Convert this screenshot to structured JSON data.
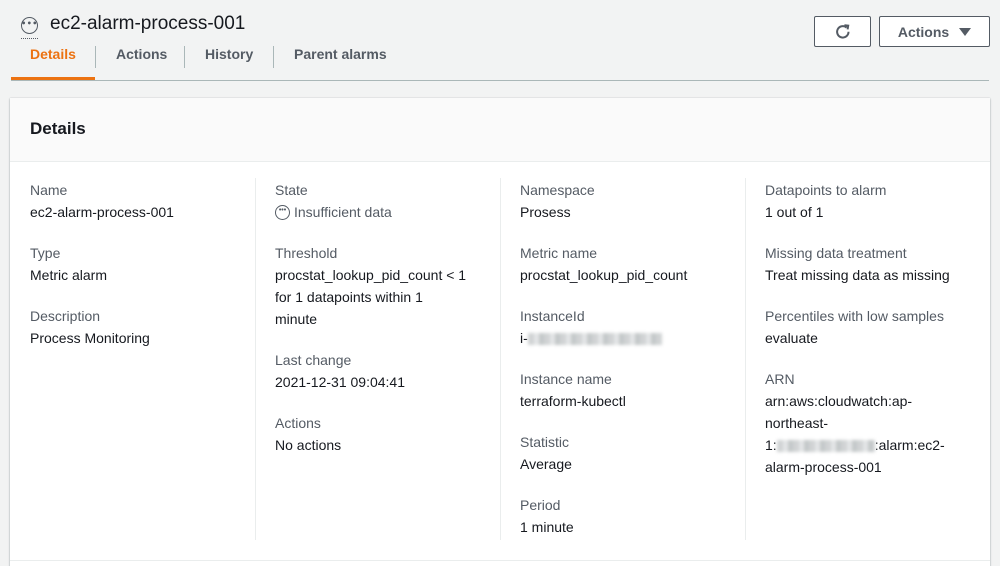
{
  "header": {
    "title": "ec2-alarm-process-001",
    "refresh_icon": "refresh-icon",
    "actions_label": "Actions"
  },
  "tabs": [
    {
      "label": "Details",
      "active": true
    },
    {
      "label": "Actions",
      "active": false
    },
    {
      "label": "History",
      "active": false
    },
    {
      "label": "Parent alarms",
      "active": false
    }
  ],
  "details": {
    "title": "Details",
    "col1": {
      "name_label": "Name",
      "name_value": "ec2-alarm-process-001",
      "type_label": "Type",
      "type_value": "Metric alarm",
      "description_label": "Description",
      "description_value": "Process Monitoring"
    },
    "col2": {
      "state_label": "State",
      "state_value": "Insufficient data",
      "threshold_label": "Threshold",
      "threshold_line1": "procstat_lookup_pid_count < 1",
      "threshold_line2": "for 1 datapoints within 1",
      "threshold_line3": "minute",
      "last_change_label": "Last change",
      "last_change_value": "2021-12-31 09:04:41",
      "actions_label": "Actions",
      "actions_value": "No actions"
    },
    "col3": {
      "namespace_label": "Namespace",
      "namespace_value": "Prosess",
      "metric_label": "Metric name",
      "metric_value": "procstat_lookup_pid_count",
      "instanceid_label": "InstanceId",
      "instanceid_prefix": "i-",
      "instance_name_label": "Instance name",
      "instance_name_value": "terraform-kubectl",
      "statistic_label": "Statistic",
      "statistic_value": "Average",
      "period_label": "Period",
      "period_value": "1 minute"
    },
    "col4": {
      "datapoints_label": "Datapoints to alarm",
      "datapoints_value": "1 out of 1",
      "missing_label": "Missing data treatment",
      "missing_value": "Treat missing data as missing",
      "percentiles_label": "Percentiles with low samples",
      "percentiles_value": "evaluate",
      "arn_label": "ARN",
      "arn_line1": "arn:aws:cloudwatch:ap-",
      "arn_line2": "northeast-",
      "arn_line3_prefix": "1:",
      "arn_line3_suffix": ":alarm:ec2-",
      "arn_line4": "alarm-process-001"
    }
  }
}
